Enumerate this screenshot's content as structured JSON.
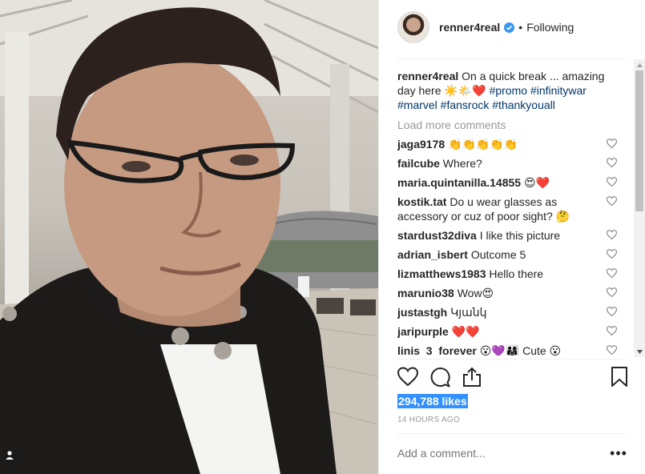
{
  "post": {
    "username": "renner4real",
    "follow_status": "Following",
    "separator": "•",
    "caption_text": "On a quick break ... amazing day here ☀️🌤️❤️",
    "caption_hashtags": "#promo #infinitywar #marvel #fansrock #thankyouall",
    "load_more": "Load more comments",
    "likes": "294,788 likes",
    "time": "14 HOURS AGO",
    "add_comment_placeholder": "Add a comment...",
    "more_options": "•••"
  },
  "comments": [
    {
      "user": "jaga9178",
      "text": "👏👏👏👏👏"
    },
    {
      "user": "failcube",
      "text": "Where?"
    },
    {
      "user": "maria.quintanilla.14855",
      "text": "😍❤️"
    },
    {
      "user": "kostik.tat",
      "text": "Do u wear glasses as accessory or cuz of poor sight? 🤔"
    },
    {
      "user": "stardust32diva",
      "text": "I like this picture"
    },
    {
      "user": "adrian_isbert",
      "text": "Outcome 5"
    },
    {
      "user": "lizmatthews1983",
      "text": "Hello there"
    },
    {
      "user": "marunio38",
      "text": "Wow😍"
    },
    {
      "user": "justastgh",
      "text": "Կյանկ"
    },
    {
      "user": "jaripurple",
      "text": "❤️❤️"
    },
    {
      "user": "linis_3_forever",
      "text": "😮💜👨‍👩‍👧 Cute 😮"
    }
  ],
  "colors": {
    "link": "#003569",
    "muted": "#999999",
    "text": "#262626",
    "verified": "#3897f0",
    "selection": "#3390ff"
  },
  "icons": [
    "verified-badge-icon",
    "heart-icon",
    "comment-icon",
    "share-icon",
    "bookmark-icon",
    "user-tag-icon",
    "small-heart-icon"
  ]
}
